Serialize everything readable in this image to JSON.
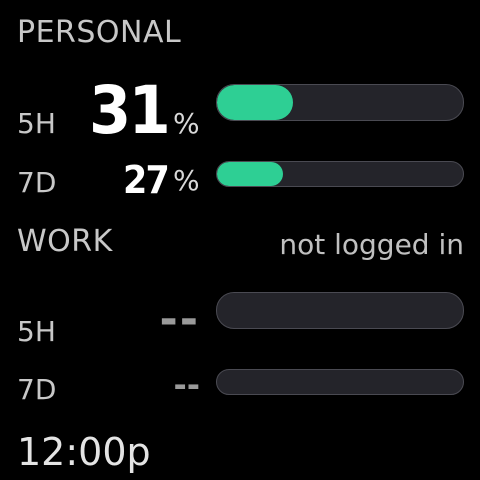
{
  "personal": {
    "title": "PERSONAL",
    "rows": [
      {
        "label": "5H",
        "value": "31",
        "unit": "%",
        "progress": 0.31
      },
      {
        "label": "7D",
        "value": "27",
        "unit": "%",
        "progress": 0.27
      }
    ]
  },
  "work": {
    "title": "WORK",
    "status": "not logged in",
    "rows": [
      {
        "label": "5H",
        "value": "--",
        "progress": 0
      },
      {
        "label": "7D",
        "value": "--",
        "progress": 0
      }
    ]
  },
  "clock": {
    "time": "12:00p"
  },
  "colors": {
    "accent": "#2ecf94",
    "track": "#24242a",
    "track_border": "#4a4a52",
    "background": "#000000"
  }
}
